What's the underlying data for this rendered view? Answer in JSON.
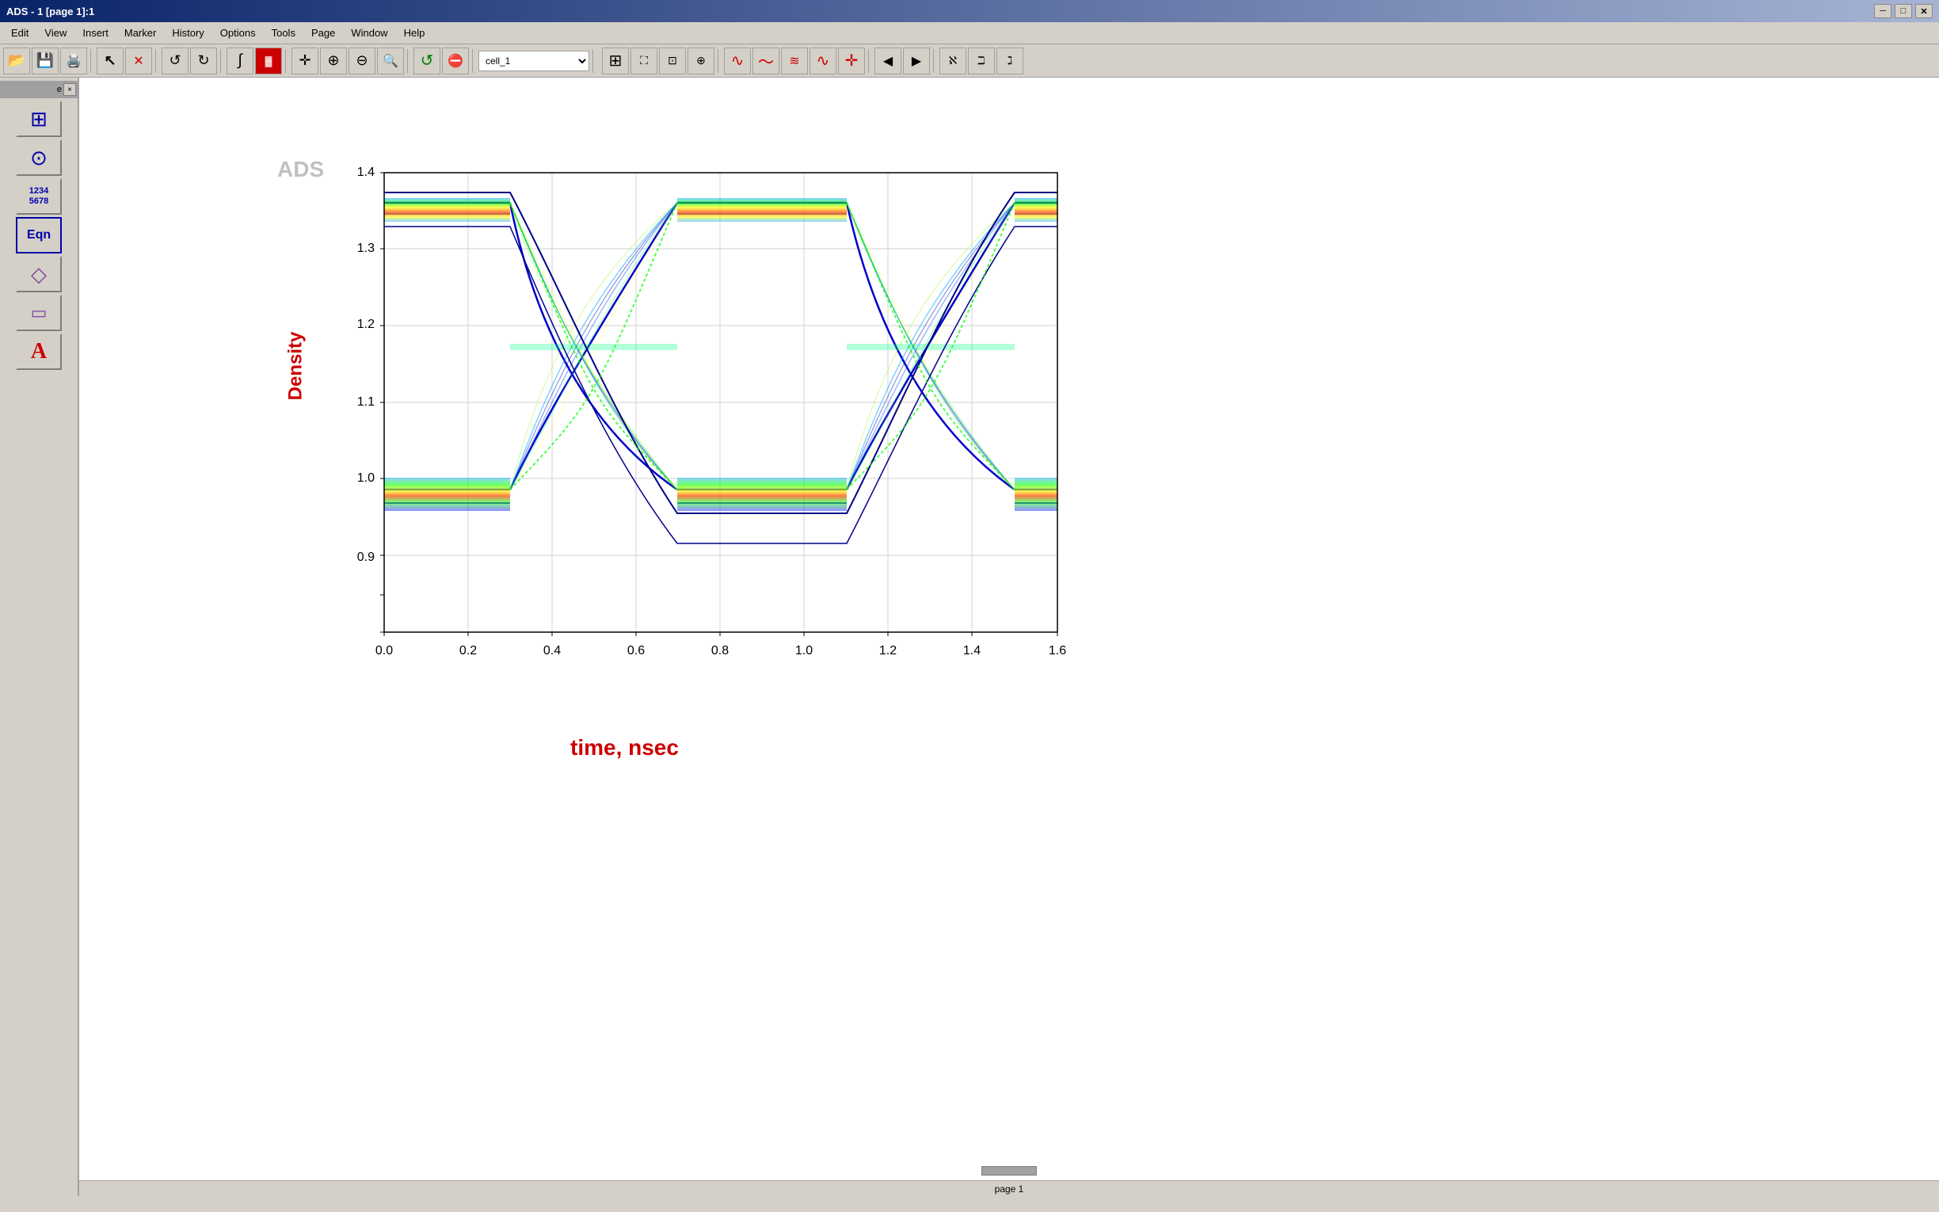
{
  "titleBar": {
    "title": "ADS - 1 [page 1]:1",
    "controls": [
      "─",
      "□",
      "✕"
    ]
  },
  "menuBar": {
    "items": [
      "Edit",
      "View",
      "Insert",
      "Marker",
      "History",
      "Options",
      "Tools",
      "Page",
      "Window",
      "Help"
    ]
  },
  "toolbar": {
    "dropdown": {
      "value": "cell_1"
    },
    "buttons": [
      "open",
      "save",
      "print",
      "separator",
      "cursor",
      "cross",
      "separator",
      "undo",
      "redo",
      "separator",
      "curve",
      "graph",
      "separator",
      "move",
      "zoom-in",
      "zoom-out",
      "zoom-area",
      "separator",
      "refresh",
      "stop"
    ]
  },
  "sidebar": {
    "header": "e",
    "tools": [
      {
        "name": "grid-tool",
        "icon": "⊞"
      },
      {
        "name": "globe-tool",
        "icon": "⊙"
      },
      {
        "name": "number-tool",
        "icon": "1234\n5678"
      },
      {
        "name": "equation-tool",
        "icon": "Eqn"
      },
      {
        "name": "arrow-tool",
        "icon": "◇"
      },
      {
        "name": "rect-tool",
        "icon": "▭"
      },
      {
        "name": "text-tool",
        "icon": "A"
      }
    ]
  },
  "chart": {
    "title": "ADS",
    "xAxisLabel": "time, nsec",
    "yAxisLabel": "Density",
    "xTicks": [
      "0.0",
      "0.2",
      "0.4",
      "0.6",
      "0.8",
      "1.0",
      "1.2",
      "1.4",
      "1.6"
    ],
    "yTicks": [
      "0.9",
      "1.0",
      "1.1",
      "1.2",
      "1.3",
      "1.4"
    ],
    "gridColor": "#d0d0d0",
    "axisColor": "#000000"
  },
  "statusBar": {
    "text": "page 1",
    "scrollThumb": true
  }
}
